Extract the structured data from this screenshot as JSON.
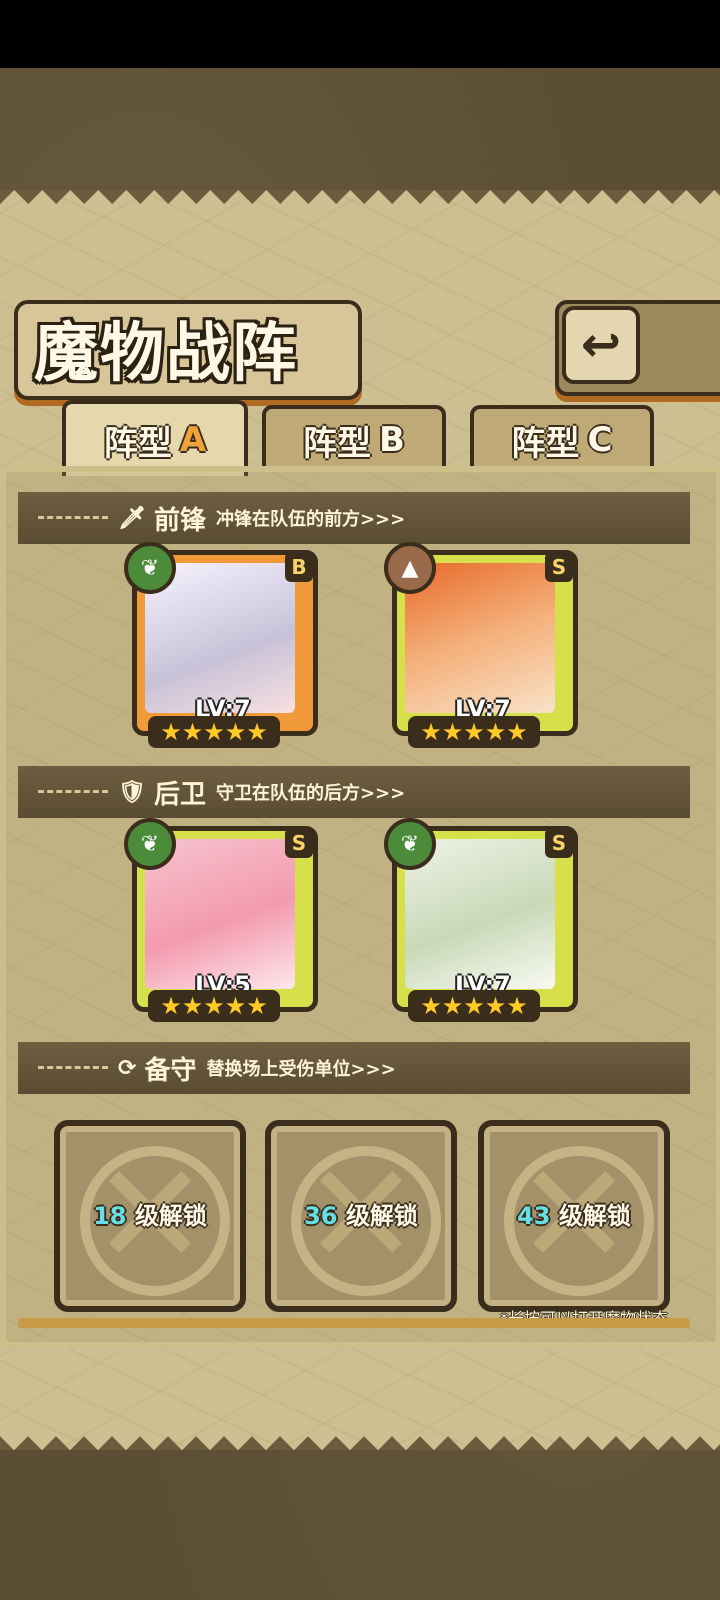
{
  "screen": {
    "title": "魔物战阵",
    "back_icon": "back-arrow-icon"
  },
  "tabs": [
    {
      "label": "阵型",
      "letter": "A",
      "active": true
    },
    {
      "label": "阵型",
      "letter": "B",
      "active": false
    },
    {
      "label": "阵型",
      "letter": "C",
      "active": false
    }
  ],
  "sections": {
    "front": {
      "title": "前锋",
      "subtitle": "冲锋在队伍的前方>>>"
    },
    "rear": {
      "title": "后卫",
      "subtitle": "守卫在队伍的后方>>>"
    },
    "reserve": {
      "title": "备守",
      "subtitle": "替换场上受伤单位>>>"
    }
  },
  "front_units": [
    {
      "rank": "B",
      "level": "LV:7",
      "stars": "★★★★★",
      "element": "grass-element-icon"
    },
    {
      "rank": "S",
      "level": "LV:7",
      "stars": "★★★★★",
      "element": "earth-element-icon"
    }
  ],
  "rear_units": [
    {
      "rank": "S",
      "level": "LV:5",
      "stars": "★★★★★",
      "element": "grass-element-icon"
    },
    {
      "rank": "S",
      "level": "LV:7",
      "stars": "★★★★★",
      "element": "grass-element-icon"
    }
  ],
  "reserve_slots": [
    {
      "level": "18",
      "text": "级解锁"
    },
    {
      "level": "36",
      "text": "级解锁"
    },
    {
      "level": "43",
      "text": "级解锁"
    }
  ],
  "hint": "*长按可以打开魔物状态",
  "colors": {
    "rank_b": "#f09a3a",
    "rank_s": "#d6e04a",
    "accent": "#f0a23a",
    "unlock_level": "#66e0e6"
  }
}
